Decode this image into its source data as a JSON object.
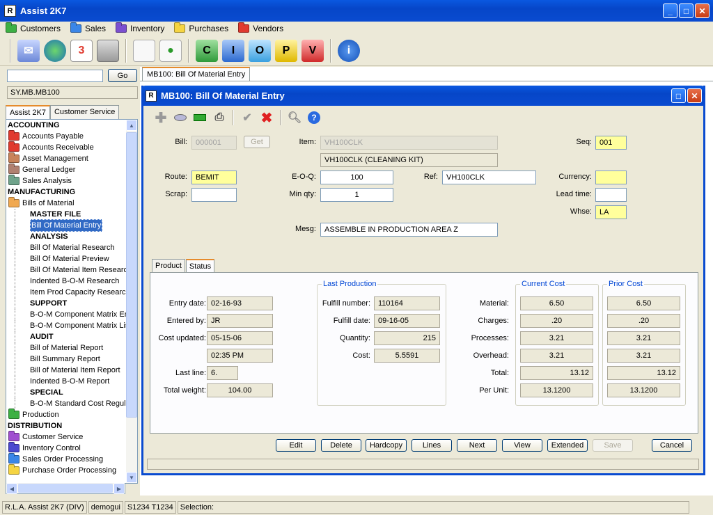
{
  "window": {
    "title": "Assist 2K7",
    "app_icon": "logo-icon"
  },
  "menubar": [
    {
      "label": "Customers",
      "color": "#3cb043"
    },
    {
      "label": "Sales",
      "color": "#3a86e8"
    },
    {
      "label": "Inventory",
      "color": "#7b4fd0"
    },
    {
      "label": "Purchases",
      "color": "#f5d442"
    },
    {
      "label": "Vendors",
      "color": "#e03a2f"
    }
  ],
  "toolbar": {
    "icons": [
      "mail-icon",
      "globe-icon",
      "calendar-icon",
      "calculator-icon",
      "document-icon",
      "chart-icon",
      "c-icon",
      "i-icon",
      "o-icon",
      "p-icon",
      "v-icon",
      "info-icon"
    ],
    "letters": {
      "c": "C",
      "i": "I",
      "o": "O",
      "p": "P",
      "v": "V"
    }
  },
  "left": {
    "go_label": "Go",
    "search_value": "",
    "path": "SY.MB.MB100",
    "tabs": [
      "Assist 2K7",
      "Customer Service"
    ],
    "tree": [
      {
        "type": "sec",
        "label": "ACCOUNTING"
      },
      {
        "type": "grp",
        "label": "Accounts Payable",
        "color": "#e03a2f"
      },
      {
        "type": "grp",
        "label": "Accounts Receivable",
        "color": "#e03a2f"
      },
      {
        "type": "grp",
        "label": "Asset Management",
        "color": "#c8835a"
      },
      {
        "type": "grp",
        "label": "General Ledger",
        "color": "#b08070"
      },
      {
        "type": "grp",
        "label": "Sales Analysis",
        "color": "#6fa38b"
      },
      {
        "type": "sec",
        "label": "MANUFACTURING"
      },
      {
        "type": "grp",
        "label": "Bills of Material",
        "color": "#f0a850"
      },
      {
        "type": "leafb",
        "label": "MASTER FILE"
      },
      {
        "type": "leafsel",
        "label": "Bill Of Material Entry"
      },
      {
        "type": "leafb",
        "label": "ANALYSIS"
      },
      {
        "type": "leaf",
        "label": "Bill Of Material Research"
      },
      {
        "type": "leaf",
        "label": "Bill Of Material Preview"
      },
      {
        "type": "leaf",
        "label": "Bill Of Material Item Research"
      },
      {
        "type": "leaf",
        "label": "Indented B-O-M Research"
      },
      {
        "type": "leaf",
        "label": "Item Prod Capacity Research"
      },
      {
        "type": "leafb",
        "label": "SUPPORT"
      },
      {
        "type": "leaf",
        "label": "B-O-M Component Matrix Entry"
      },
      {
        "type": "leaf",
        "label": "B-O-M Component Matrix List"
      },
      {
        "type": "leafb",
        "label": "AUDIT"
      },
      {
        "type": "leaf",
        "label": "Bill of Material Report"
      },
      {
        "type": "leaf",
        "label": "Bill Summary Report"
      },
      {
        "type": "leaf",
        "label": "Bill of Material Item Report"
      },
      {
        "type": "leaf",
        "label": "Indented B-O-M Report"
      },
      {
        "type": "leafb",
        "label": "SPECIAL"
      },
      {
        "type": "leaf",
        "label": "B-O-M Standard Cost Regulato"
      },
      {
        "type": "grp",
        "label": "Production",
        "color": "#3cb043"
      },
      {
        "type": "sec",
        "label": "DISTRIBUTION"
      },
      {
        "type": "grp",
        "label": "Customer Service",
        "color": "#a050d0"
      },
      {
        "type": "grp",
        "label": "Inventory Control",
        "color": "#4a48d0"
      },
      {
        "type": "grp",
        "label": "Sales Order Processing",
        "color": "#3a86e8"
      },
      {
        "type": "grp",
        "label": "Purchase Order Processing",
        "color": "#f5d442"
      }
    ]
  },
  "doc_tab": "MB100: Bill Of Material Entry",
  "form": {
    "title": "MB100: Bill Of Material Entry",
    "labels": {
      "bill": "Bill:",
      "item": "Item:",
      "seq": "Seq:",
      "route": "Route:",
      "eoq": "E-O-Q:",
      "ref": "Ref:",
      "currency": "Currency:",
      "scrap": "Scrap:",
      "minqty": "Min qty:",
      "leadtime": "Lead time:",
      "whse": "Whse:",
      "mesg": "Mesg:"
    },
    "get_label": "Get",
    "bill": "000001",
    "item": "VH100CLK",
    "item_desc": "VH100CLK (CLEANING KIT)",
    "seq": "001",
    "route": "BEMIT",
    "eoq": "100",
    "ref": "VH100CLK",
    "currency": "",
    "scrap": "",
    "minqty": "1",
    "leadtime": "",
    "whse": "LA",
    "mesg": "ASSEMBLE IN PRODUCTION AREA Z",
    "tabs": [
      "Product",
      "Status"
    ]
  },
  "status": {
    "labels": {
      "entry_date": "Entry date:",
      "entered_by": "Entered by:",
      "cost_updated": "Cost updated:",
      "last_line": "Last line:",
      "total_weight": "Total weight:"
    },
    "entry_date": "02-16-93",
    "entered_by": "JR",
    "cost_updated": "05-15-06",
    "cost_time": "02:35 PM",
    "last_line": "6.",
    "total_weight": "104.00",
    "last_production": {
      "title": "Last Production",
      "labels": {
        "fulfill_number": "Fulfill number:",
        "fulfill_date": "Fulfill date:",
        "quantity": "Quantity:",
        "cost": "Cost:"
      },
      "fulfill_number": "110164",
      "fulfill_date": "09-16-05",
      "quantity": "215",
      "cost": "5.5591"
    },
    "cost_labels": {
      "material": "Material:",
      "charges": "Charges:",
      "processes": "Processes:",
      "overhead": "Overhead:",
      "total": "Total:",
      "per_unit": "Per Unit:"
    },
    "current_cost": {
      "title": "Current Cost",
      "material": "6.50",
      "charges": ".20",
      "processes": "3.21",
      "overhead": "3.21",
      "total": "13.12",
      "per_unit": "13.1200"
    },
    "prior_cost": {
      "title": "Prior Cost",
      "material": "6.50",
      "charges": ".20",
      "processes": "3.21",
      "overhead": "3.21",
      "total": "13.12",
      "per_unit": "13.1200"
    }
  },
  "buttons": [
    "Edit",
    "Delete",
    "Hardcopy",
    "Lines",
    "Next",
    "View",
    "Extended",
    "Save",
    "Cancel"
  ],
  "statusbar": [
    "R.L.A. Assist 2K7 (DIV)",
    "demogui",
    "S1234 T1234",
    "Selection:"
  ]
}
